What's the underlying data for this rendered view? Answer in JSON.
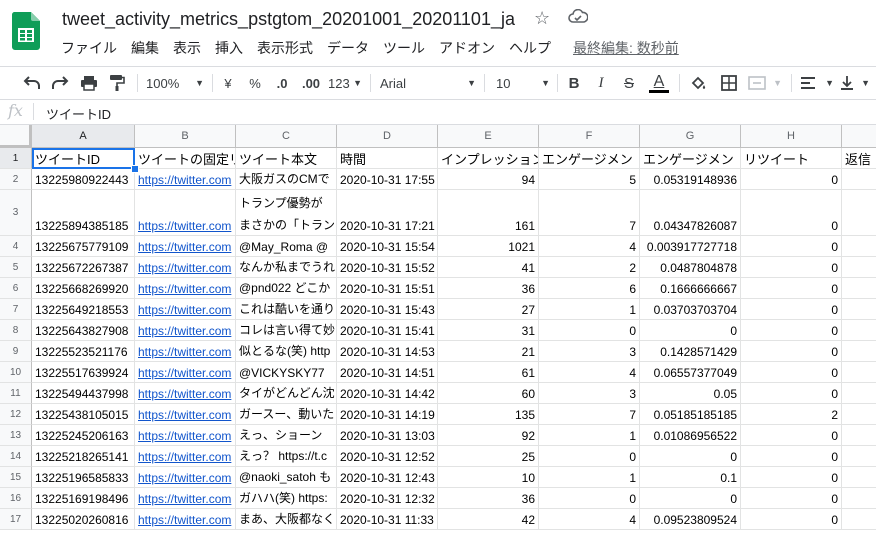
{
  "document": {
    "title": "tweet_activity_metrics_pstgtom_20201001_20201101_ja",
    "last_edit": "最終編集: 数秒前"
  },
  "menu": [
    "ファイル",
    "編集",
    "表示",
    "挿入",
    "表示形式",
    "データ",
    "ツール",
    "アドオン",
    "ヘルプ"
  ],
  "toolbar": {
    "zoom": "100%",
    "currency": "¥",
    "percent": "%",
    "decimal_decrease": ".0",
    "decimal_increase": ".00",
    "more_formats": "123",
    "font": "Arial",
    "font_size": "10",
    "bold": "B",
    "italic": "I",
    "text_color": "A"
  },
  "formula_bar": {
    "icon": "fx",
    "value": "ツイートID"
  },
  "columns": [
    "A",
    "B",
    "C",
    "D",
    "E",
    "F",
    "G",
    "H"
  ],
  "headers": [
    "ツイートID",
    "ツイートの固定リ",
    "ツイート本文",
    "時間",
    "インプレッション",
    "エンゲージメン",
    "エンゲージメン",
    "リツイート",
    "返信"
  ],
  "rows": [
    {
      "n": "2",
      "id": "13225980922443",
      "link": "https://twitter.com",
      "text": "大阪ガスのCMで",
      "time": "2020-10-31 17:55",
      "imp": "94",
      "eng": "5",
      "rate": "0.05319148936",
      "rt": "0"
    },
    {
      "n": "3",
      "id": "13225894385185",
      "link": "https://twitter.com",
      "text": "トランプ優勢が",
      "text2": "まさかの「トラン",
      "time": "2020-10-31 17:21",
      "imp": "161",
      "eng": "7",
      "rate": "0.04347826087",
      "rt": "0"
    },
    {
      "n": "4",
      "id": "13225675779109",
      "link": "https://twitter.com",
      "text": "@May_Roma @",
      "time": "2020-10-31 15:54",
      "imp": "1021",
      "eng": "4",
      "rate": "0.003917727718",
      "rt": "0"
    },
    {
      "n": "5",
      "id": "13225672267387",
      "link": "https://twitter.com",
      "text": "なんか私までうれ",
      "time": "2020-10-31 15:52",
      "imp": "41",
      "eng": "2",
      "rate": "0.0487804878",
      "rt": "0"
    },
    {
      "n": "6",
      "id": "13225668269920",
      "link": "https://twitter.com",
      "text": "@pnd022 どこか",
      "time": "2020-10-31 15:51",
      "imp": "36",
      "eng": "6",
      "rate": "0.1666666667",
      "rt": "0"
    },
    {
      "n": "7",
      "id": "13225649218553",
      "link": "https://twitter.com",
      "text": "これは酷いを通り",
      "time": "2020-10-31 15:43",
      "imp": "27",
      "eng": "1",
      "rate": "0.03703703704",
      "rt": "0"
    },
    {
      "n": "8",
      "id": "13225643827908",
      "link": "https://twitter.com",
      "text": "コレは言い得て妙",
      "time": "2020-10-31 15:41",
      "imp": "31",
      "eng": "0",
      "rate": "0",
      "rt": "0"
    },
    {
      "n": "9",
      "id": "13225523521176",
      "link": "https://twitter.com",
      "text": "似とるな(笑) http",
      "time": "2020-10-31 14:53",
      "imp": "21",
      "eng": "3",
      "rate": "0.1428571429",
      "rt": "0"
    },
    {
      "n": "10",
      "id": "13225517639924",
      "link": "https://twitter.com",
      "text": "@VICKYSKY77",
      "time": "2020-10-31 14:51",
      "imp": "61",
      "eng": "4",
      "rate": "0.06557377049",
      "rt": "0"
    },
    {
      "n": "11",
      "id": "13225494437998",
      "link": "https://twitter.com",
      "text": "タイがどんどん沈",
      "time": "2020-10-31 14:42",
      "imp": "60",
      "eng": "3",
      "rate": "0.05",
      "rt": "0"
    },
    {
      "n": "12",
      "id": "13225438105015",
      "link": "https://twitter.com",
      "text": "ガースー、動いた",
      "time": "2020-10-31 14:19",
      "imp": "135",
      "eng": "7",
      "rate": "0.05185185185",
      "rt": "2"
    },
    {
      "n": "13",
      "id": "13225245206163",
      "link": "https://twitter.com",
      "text": "えっ、ショーン",
      "time": "2020-10-31 13:03",
      "imp": "92",
      "eng": "1",
      "rate": "0.01086956522",
      "rt": "0"
    },
    {
      "n": "14",
      "id": "13225218265141",
      "link": "https://twitter.com",
      "text": "えっ？ https://t.c",
      "time": "2020-10-31 12:52",
      "imp": "25",
      "eng": "0",
      "rate": "0",
      "rt": "0"
    },
    {
      "n": "15",
      "id": "13225196585833",
      "link": "https://twitter.com",
      "text": "@naoki_satoh も",
      "time": "2020-10-31 12:43",
      "imp": "10",
      "eng": "1",
      "rate": "0.1",
      "rt": "0"
    },
    {
      "n": "16",
      "id": "13225169198496",
      "link": "https://twitter.com",
      "text": "ガハハ(笑) https:",
      "time": "2020-10-31 12:32",
      "imp": "36",
      "eng": "0",
      "rate": "0",
      "rt": "0"
    },
    {
      "n": "17",
      "id": "13225020260816",
      "link": "https://twitter.com",
      "text": "まあ、大阪都なく",
      "time": "2020-10-31 11:33",
      "imp": "42",
      "eng": "4",
      "rate": "0.09523809524",
      "rt": "0"
    }
  ],
  "colors": {
    "accent": "#1a73e8",
    "link": "#1155cc",
    "sheets_green": "#0f9d58"
  }
}
